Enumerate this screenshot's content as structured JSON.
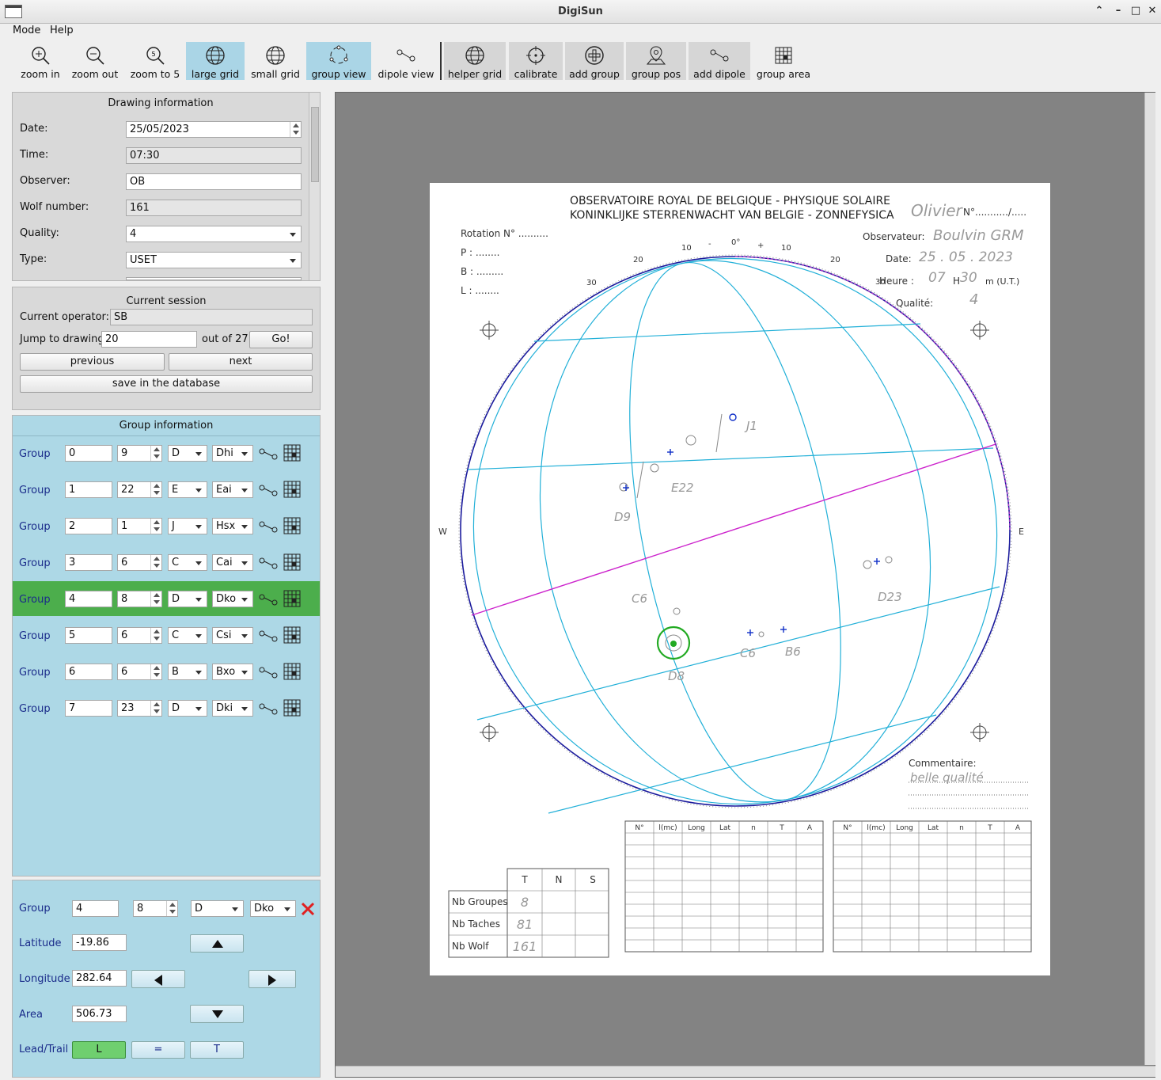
{
  "window": {
    "title": "DigiSun"
  },
  "menu": [
    "Mode",
    "Help"
  ],
  "toolbar": [
    {
      "label": "zoom in",
      "icon": "zoom-in-icon"
    },
    {
      "label": "zoom out",
      "icon": "zoom-out-icon"
    },
    {
      "label": "zoom to 5",
      "icon": "zoom-to-5-icon"
    },
    {
      "label": "large grid",
      "icon": "globe-icon",
      "active": true
    },
    {
      "label": "small grid",
      "icon": "globe-icon"
    },
    {
      "label": "group view",
      "icon": "group-view-icon",
      "active": true
    },
    {
      "label": "dipole view",
      "icon": "dipole-icon"
    },
    {
      "label": "helper grid",
      "icon": "globe-icon"
    },
    {
      "label": "calibrate",
      "icon": "crosshair-icon"
    },
    {
      "label": "add group",
      "icon": "plus-circle-icon"
    },
    {
      "label": "group pos",
      "icon": "map-pin-icon"
    },
    {
      "label": "add dipole",
      "icon": "dipole-icon"
    },
    {
      "label": "group area",
      "icon": "area-grid-icon"
    }
  ],
  "drawing_info": {
    "title": "Drawing information",
    "date_label": "Date:",
    "date": "25/05/2023",
    "time_label": "Time:",
    "time": "07:30",
    "observer_label": "Observer:",
    "observer": "OB",
    "wolf_label": "Wolf number:",
    "wolf": "161",
    "quality_label": "Quality:",
    "quality": "4",
    "type_label": "Type:",
    "type": "USET"
  },
  "session": {
    "title": "Current session",
    "operator_label": "Current operator:",
    "operator": "SB",
    "jump_label": "Jump to drawing",
    "jump_value": "20",
    "out_of": "out of 27",
    "go": "Go!",
    "previous": "previous",
    "next": "next",
    "save": "save in the database"
  },
  "group_info": {
    "title": "Group information",
    "row_label": "Group",
    "groups": [
      {
        "id": "0",
        "spots": "9",
        "zurich": "D",
        "mcintosh": "Dhi"
      },
      {
        "id": "1",
        "spots": "22",
        "zurich": "E",
        "mcintosh": "Eai"
      },
      {
        "id": "2",
        "spots": "1",
        "zurich": "J",
        "mcintosh": "Hsx"
      },
      {
        "id": "3",
        "spots": "6",
        "zurich": "C",
        "mcintosh": "Cai"
      },
      {
        "id": "4",
        "spots": "8",
        "zurich": "D",
        "mcintosh": "Dko",
        "selected": true
      },
      {
        "id": "5",
        "spots": "6",
        "zurich": "C",
        "mcintosh": "Csi"
      },
      {
        "id": "6",
        "spots": "6",
        "zurich": "B",
        "mcintosh": "Bxo"
      },
      {
        "id": "7",
        "spots": "23",
        "zurich": "D",
        "mcintosh": "Dki"
      }
    ]
  },
  "selected_group": {
    "group_label": "Group",
    "id": "4",
    "spots": "8",
    "zurich": "D",
    "mcintosh": "Dko",
    "latitude_label": "Latitude",
    "latitude": "-19.86",
    "longitude_label": "Longitude",
    "longitude": "282.64",
    "area_label": "Area",
    "area": "506.73",
    "leadtrail_label": "Lead/Trail",
    "lead": "L",
    "equal": "=",
    "trail": "T"
  },
  "sheet": {
    "header1": "OBSERVATOIRE ROYAL DE BELGIQUE - PHYSIQUE SOLAIRE",
    "header2": "KONINKLIJKE STERRENWACHT VAN BELGIE - ZONNEFYSICA",
    "rotation": "Rotation N° ..........",
    "p": "P : ........",
    "b0": "B  : .........",
    "l0": "L  : ........",
    "number": "N°.........../.....",
    "observer_label": "Observateur:",
    "date_label": "Date:",
    "hour_label": "Heure :",
    "hour_value": "H",
    "hour_unit": "m (U.T.)",
    "quality_label": "Qualité:",
    "hw_name": "Olivier",
    "hw_observer": "Boulvin GRM",
    "hw_date": "25 . 05 . 2023",
    "hw_hour": "07",
    "hw_min": "30",
    "hw_quality": "4",
    "comment_label": "Commentaire:",
    "hw_comment": "belle qualité",
    "west": "W",
    "east": "E",
    "limb_ticks": [
      "30",
      "20",
      "10",
      "-",
      "0°",
      "+",
      "10",
      "20",
      "30"
    ],
    "group_labels": [
      "J1",
      "E22",
      "D9",
      "C6",
      "D8",
      "C6",
      "B6",
      "D23"
    ],
    "table_cols": [
      "N°",
      "l(mc)",
      "Long",
      "Lat",
      "n",
      "T",
      "A"
    ],
    "summary_cols": [
      "T",
      "N",
      "S"
    ],
    "summary_rows": [
      {
        "label": "Nb Groupes",
        "t": "8"
      },
      {
        "label": "Nb Taches",
        "t": "81"
      },
      {
        "label": "Nb Wolf",
        "t": "161"
      }
    ]
  }
}
